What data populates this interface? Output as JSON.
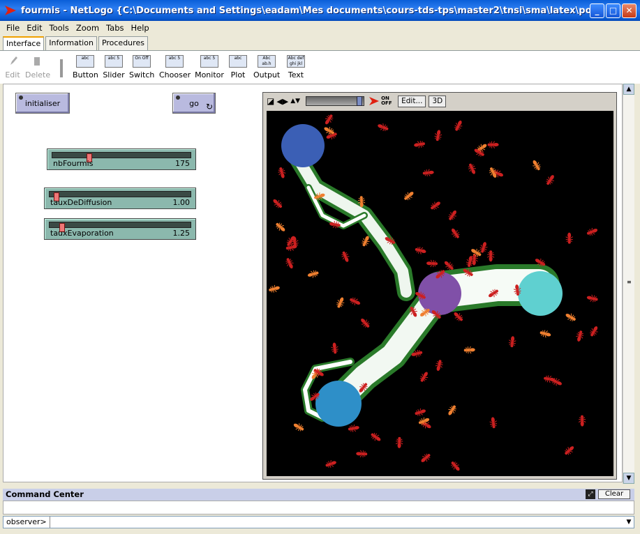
{
  "window": {
    "title": "fourmis - NetLogo {C:\\Documents and Settings\\eadam\\Mes documents\\cours-tds-tps\\master2\\tnsi\\sma\\latex\\poa_reactifs}"
  },
  "menu": [
    "File",
    "Edit",
    "Tools",
    "Zoom",
    "Tabs",
    "Help"
  ],
  "tabs": [
    "Interface",
    "Information",
    "Procedures"
  ],
  "toolbar": {
    "edit": "Edit",
    "delete": "Delete",
    "widgets": [
      {
        "label": "Button",
        "icon": "abc"
      },
      {
        "label": "Slider",
        "icon": "abc 5"
      },
      {
        "label": "Switch",
        "icon": "On Off"
      },
      {
        "label": "Chooser",
        "icon": "abc 5"
      },
      {
        "label": "Monitor",
        "icon": "abc 5"
      },
      {
        "label": "Plot",
        "icon": "abc"
      },
      {
        "label": "Output",
        "icon": "Abc ab.h"
      },
      {
        "label": "Text",
        "icon": "Abc def ghi jkl"
      }
    ]
  },
  "buttons": {
    "init": "initialiser",
    "go": "go"
  },
  "sliders": [
    {
      "name": "nbFourmis",
      "value": "175",
      "fraction": 0.27
    },
    {
      "name": "tauxDeDiffusion",
      "value": "1.00",
      "fraction": 0.05
    },
    {
      "name": "tauxEvaporation",
      "value": "1.25",
      "fraction": 0.09
    }
  ],
  "view": {
    "edit": "Edit...",
    "three_d": "3D",
    "onoff": "ON OFF"
  },
  "command_center": {
    "title": "Command Center",
    "clear": "Clear",
    "prompt": "observer>"
  },
  "colors": {
    "food1": "#3b5fb5",
    "food2": "#2e8fc8",
    "food3": "#5fd0d0",
    "nest": "#8050a8",
    "ant": "#cc2020"
  }
}
